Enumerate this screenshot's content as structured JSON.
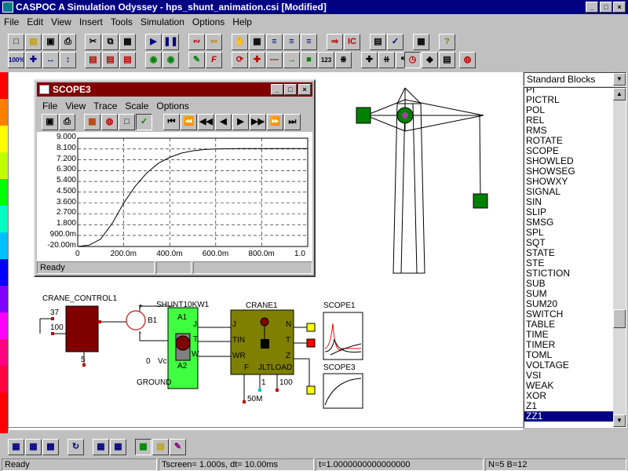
{
  "window": {
    "title": "CASPOC A Simulation Odyssey - hps_shunt_animation.csi [Modified]",
    "controls": [
      "_",
      "□",
      "×"
    ]
  },
  "menu": [
    "File",
    "Edit",
    "View",
    "Insert",
    "Tools",
    "Simulation",
    "Options",
    "Help"
  ],
  "toolbar": {
    "zoom_label": "100%",
    "counter_label": "123"
  },
  "scope_window": {
    "title": "SCOPE3",
    "menu": [
      "File",
      "View",
      "Trace",
      "Scale",
      "Options"
    ],
    "y_ticks": [
      "9.000",
      "8.100",
      "7.200",
      "6.300",
      "5.400",
      "4.500",
      "3.600",
      "2.700",
      "1.800",
      "900.0m",
      "-20.00m"
    ],
    "x_ticks": [
      "0",
      "200.0m",
      "400.0m",
      "600.0m",
      "800.0m",
      "1.0"
    ],
    "status": "Ready"
  },
  "chart_data": {
    "type": "line",
    "x": [
      0,
      0.05,
      0.1,
      0.15,
      0.2,
      0.25,
      0.3,
      0.35,
      0.4,
      0.45,
      0.5,
      0.55,
      0.6,
      0.65,
      0.7,
      0.8,
      0.9,
      1.0
    ],
    "y": [
      -0.02,
      0.1,
      0.6,
      1.9,
      3.6,
      5.0,
      6.1,
      6.9,
      7.4,
      7.75,
      7.95,
      8.05,
      8.1,
      8.12,
      8.13,
      8.14,
      8.14,
      8.14
    ],
    "ylim": [
      -0.02,
      9.0
    ],
    "xlim": [
      0,
      1.0
    ],
    "grid": true
  },
  "schematic": {
    "crane_control": "CRANE_CONTROL1",
    "cc_value_37": "37",
    "cc_value_100": "100",
    "cc_value_5": "5",
    "shunt": "SHUNT10KW1",
    "b1": "B1",
    "plus": "+",
    "minus": "-",
    "zero": "0",
    "vc": "Vc",
    "a1": "A1",
    "a2": "A2",
    "ground": "GROUND",
    "crane": "CRANE1",
    "port_j": "J",
    "port_tin": "TIN",
    "port_wr": "WR",
    "port_f": "F",
    "port_jltload": "JLTLOAD",
    "port_n": "N",
    "port_t": "T",
    "port_z": "Z",
    "out_j": "J",
    "out_t": "T",
    "out_w": "W",
    "val_1": "1",
    "val_100": "100",
    "val_50m": "50M",
    "scope1": "SCOPE1",
    "scope3": "SCOPE3"
  },
  "library": {
    "category": "Standard Blocks",
    "items": [
      "PI",
      "PICTRL",
      "POL",
      "REL",
      "RMS",
      "ROTATE",
      "SCOPE",
      "SHOWLED",
      "SHOWSEG",
      "SHOWXY",
      "SIGNAL",
      "SIN",
      "SLIP",
      "SMSG",
      "SPL",
      "SQT",
      "STATE",
      "STE",
      "STICTION",
      "SUB",
      "SUM",
      "SUM20",
      "SWITCH",
      "TABLE",
      "TIME",
      "TIMER",
      "TOML",
      "VOLTAGE",
      "VSI",
      "WEAK",
      "XOR",
      "Z1",
      "ZZ1"
    ],
    "selected": "ZZ1"
  },
  "status": {
    "ready": "Ready",
    "tscreen": "Tscreen= 1.000s, dt= 10.00ms",
    "time": "t=1.0000000000000000",
    "counts": "N=5 B=12"
  },
  "colors": {
    "titlebar": "#000080",
    "scope_titlebar": "#800000",
    "block_dark_red": "#800000",
    "shunt_green": "#40ff40",
    "crane_olive": "#808000",
    "crane_node": "#008000"
  }
}
